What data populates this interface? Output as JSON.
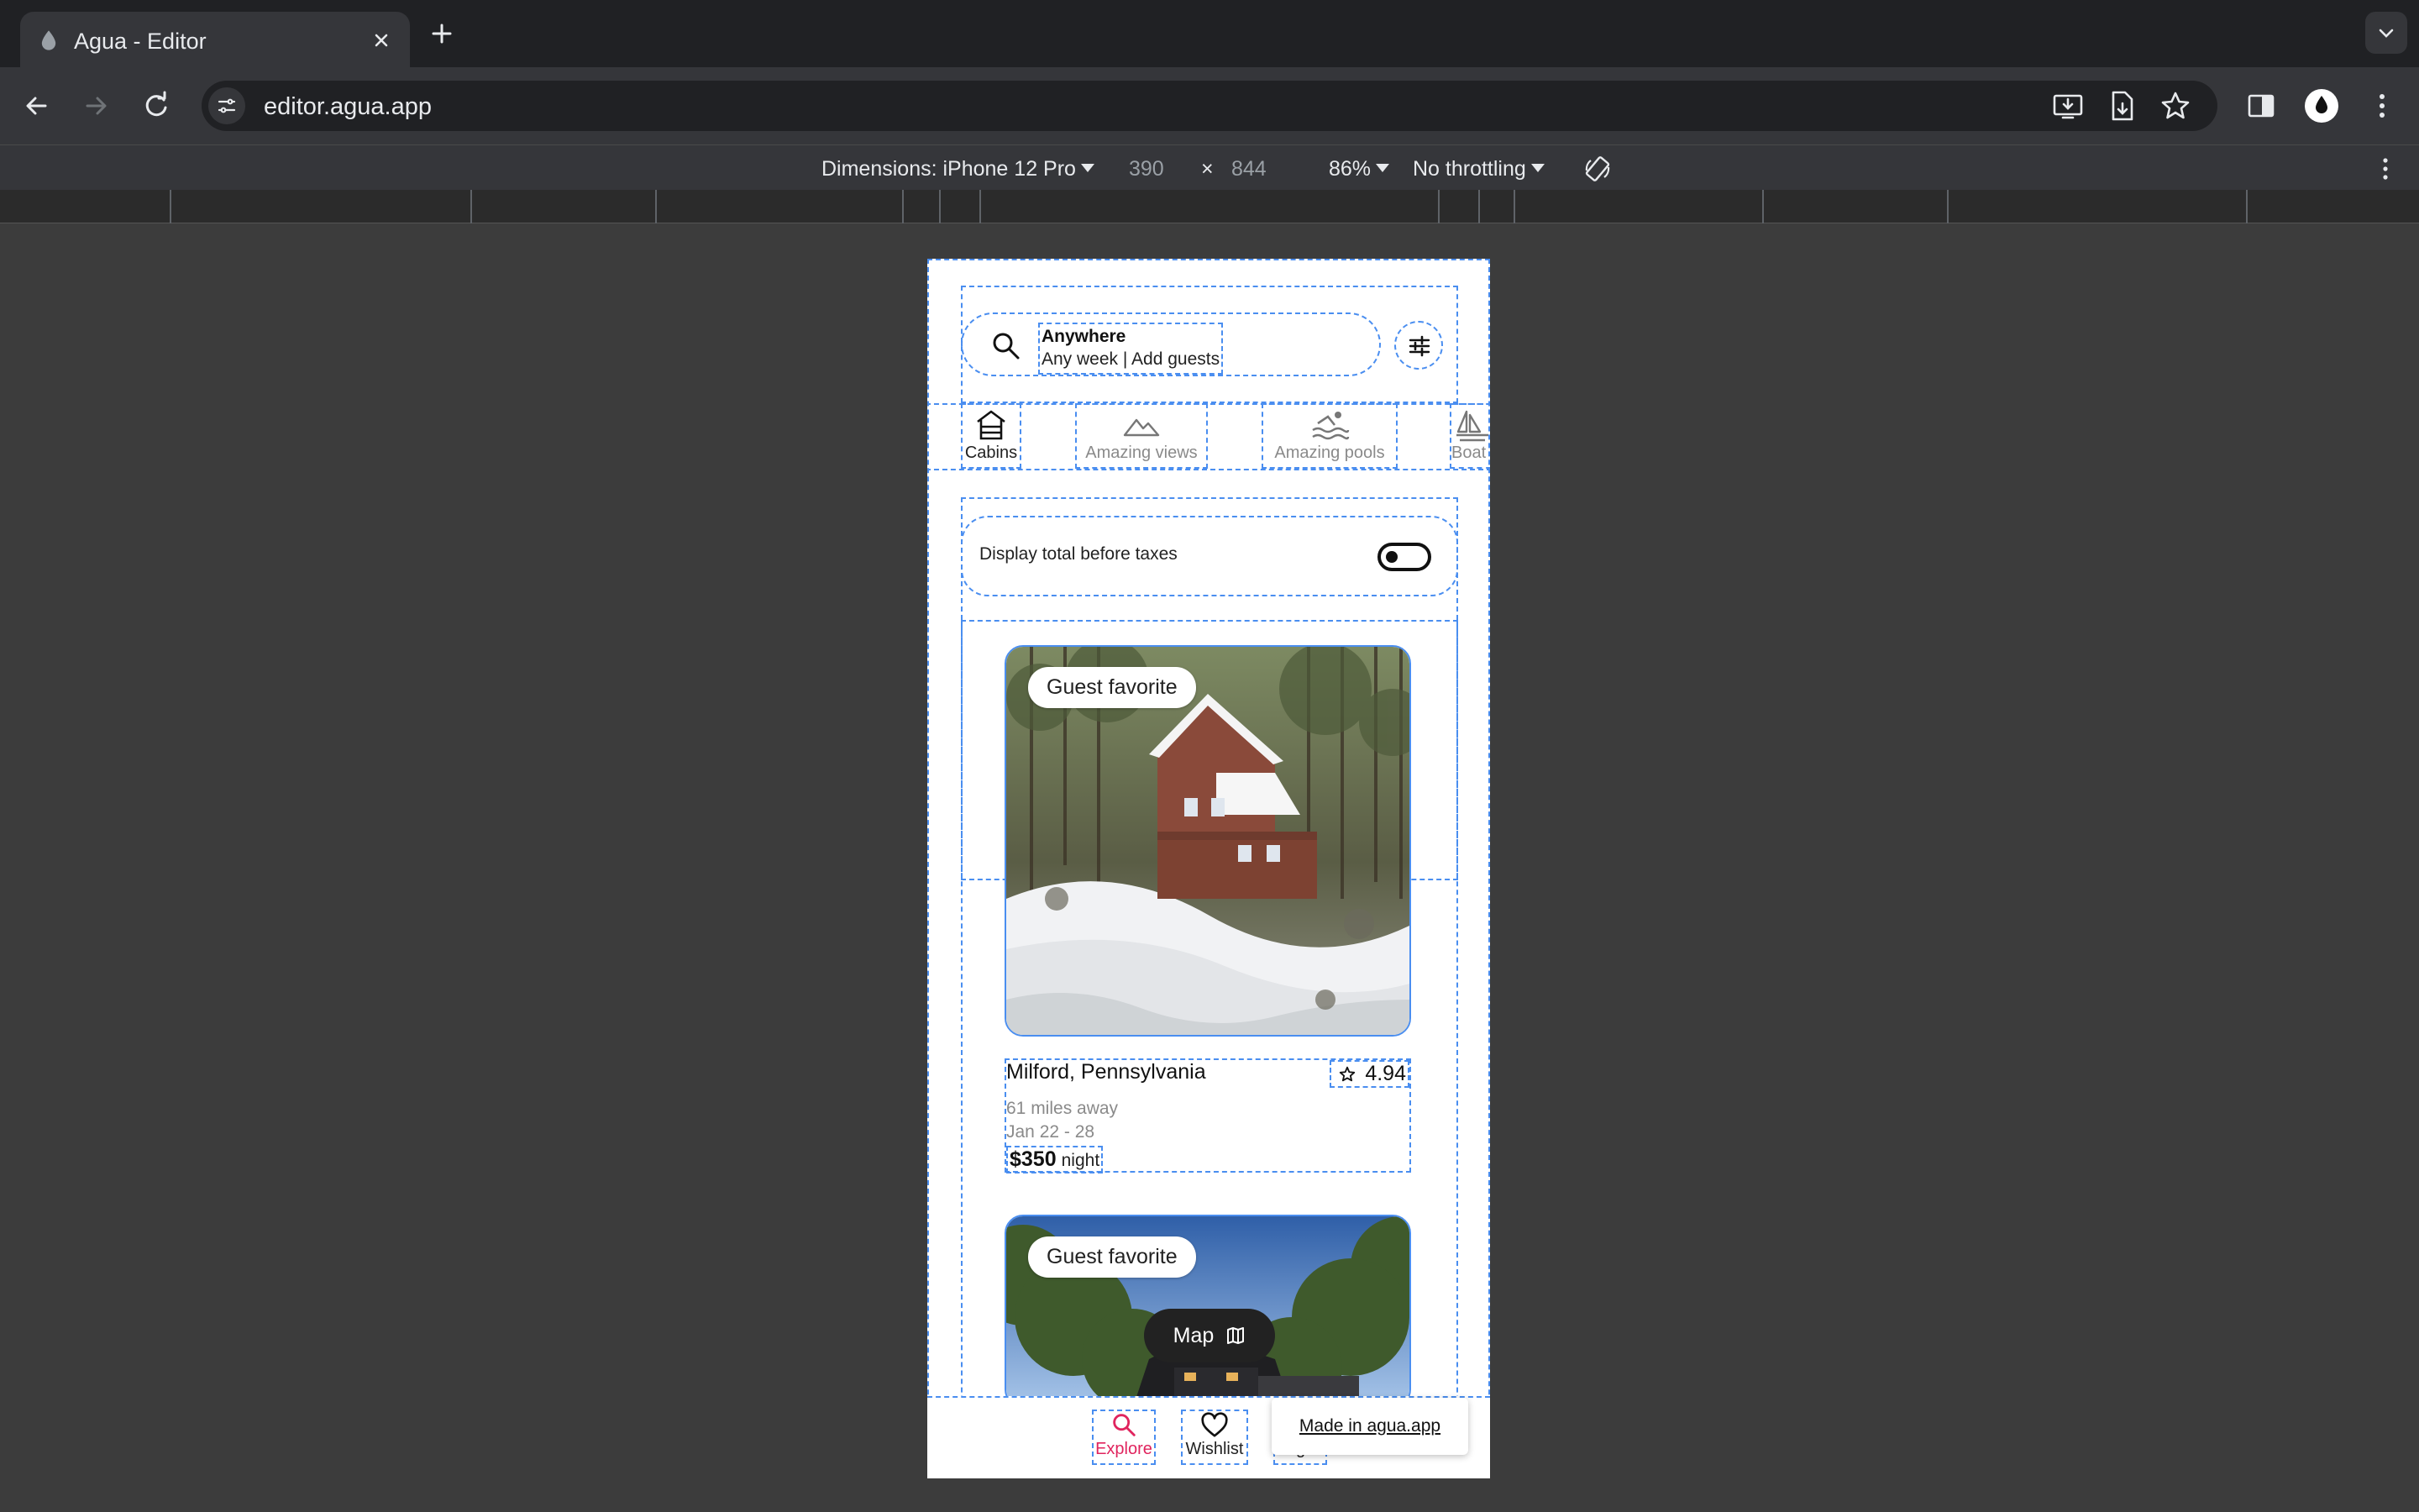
{
  "browser": {
    "tab_title": "Agua - Editor",
    "url": "editor.agua.app"
  },
  "device_toolbar": {
    "dimensions_label": "Dimensions: iPhone 12 Pro",
    "width": "390",
    "times": "×",
    "height": "844",
    "zoom": "86%",
    "throttling": "No throttling"
  },
  "app": {
    "search": {
      "title": "Anywhere",
      "subtitle": "Any week | Add guests"
    },
    "categories": [
      {
        "label": "Cabins",
        "icon": "cabin-icon",
        "active": true
      },
      {
        "label": "Amazing views",
        "icon": "mountain-icon",
        "active": false
      },
      {
        "label": "Amazing pools",
        "icon": "pool-icon",
        "active": false
      },
      {
        "label": "Boat",
        "icon": "boat-icon",
        "active": false
      }
    ],
    "taxes_toggle": {
      "label": "Display total before taxes",
      "on": false
    },
    "listings": [
      {
        "badge": "Guest favorite",
        "location": "Milford, Pennsylvania",
        "rating": "4.94",
        "distance": "61 miles away",
        "dates": "Jan 22 - 28",
        "price": "$350",
        "per": "night"
      },
      {
        "badge": "Guest favorite"
      }
    ],
    "map_button": "Map",
    "bottom_nav": {
      "explore": "Explore",
      "wishlist": "Wishlist",
      "login": "Log in"
    },
    "made_in": "Made in agua.app"
  },
  "colors": {
    "accent": "#e0245e",
    "outline": "#4a8ef0",
    "chrome_bg": "#35363a",
    "page_bg": "#3c3c3c"
  }
}
